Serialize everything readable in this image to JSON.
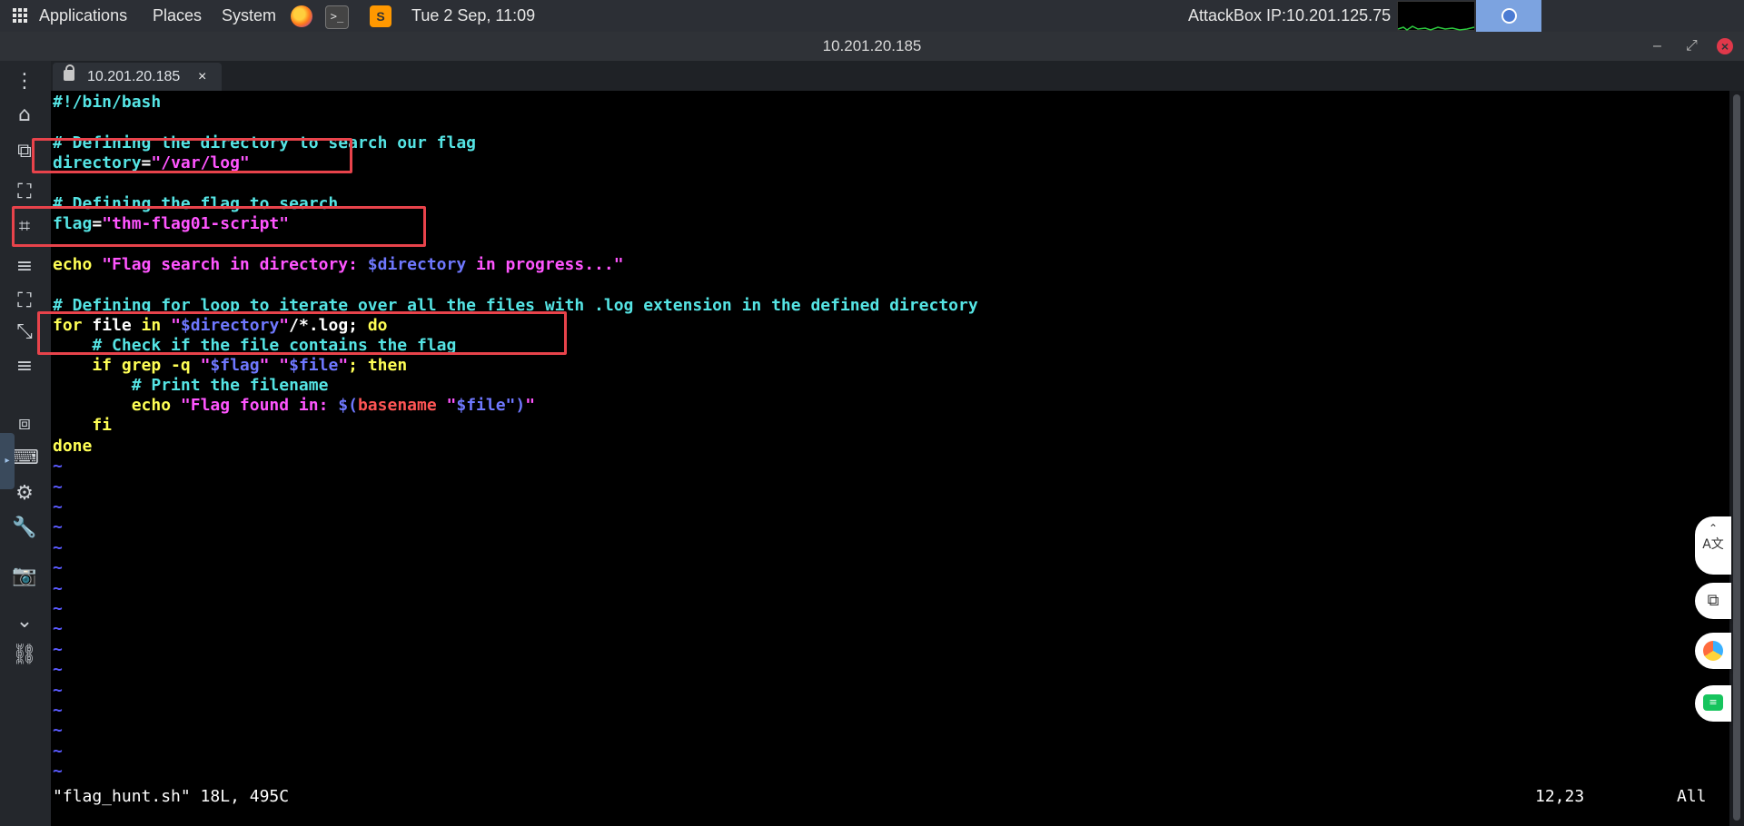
{
  "panel": {
    "applications": "Applications",
    "places": "Places",
    "system": "System",
    "datetime": "Tue 2 Sep, 11:09",
    "attackbox_ip": "AttackBox IP:10.201.125.75"
  },
  "window": {
    "title": "10.201.20.185",
    "minimize": "–",
    "maximize": "⤢",
    "close": "×"
  },
  "tab": {
    "label": "10.201.20.185",
    "close": "×"
  },
  "script_lines": {
    "l1": "#!/bin/bash",
    "l3": "# Defining the directory to search our flag",
    "l4a": "directory",
    "l4b": "=",
    "l4c": "\"/var/log\"",
    "l6": "# Defining the flag to search",
    "l7a": "flag",
    "l7b": "=",
    "l7c": "\"thm-flag01-script\"",
    "l9a": "echo ",
    "l9b": "\"Flag search in directory: ",
    "l9c": "$directory",
    "l9d": " in progress...\"",
    "l11": "# Defining for loop to iterate over all the files with .log extension in the defined directory",
    "l12a": "for",
    "l12b": " file ",
    "l12c": "in",
    "l12d": " \"",
    "l12e": "$directory",
    "l12f": "\"",
    "l12g": "/*.log; ",
    "l12h": "do",
    "l13": "    # Check if the file contains the flag",
    "l14a": "    if grep -q ",
    "l14b": "\"",
    "l14c": "$flag",
    "l14d": "\"",
    "l14e": " \"",
    "l14f": "$file",
    "l14g": "\"",
    "l14h": "; then",
    "l15": "        # Print the filename",
    "l16a": "        echo ",
    "l16b": "\"Flag found in: ",
    "l16c": "$(",
    "l16d": "basename",
    "l16e": " \"",
    "l16f": "$file",
    "l16g": "\")",
    "l16h": "\"",
    "l17": "    fi",
    "l18": "done",
    "tilde": "~"
  },
  "status_bar": {
    "file_info": "\"flag_hunt.sh\" 18L, 495C",
    "cursor_pos": "12,23",
    "scroll_pos": "All"
  },
  "colors": {
    "comment": "#55e4e4",
    "string": "#ff55ff",
    "keyword": "#ffff55",
    "variable": "#6f78ff",
    "annotation_box": "#e8434b"
  }
}
